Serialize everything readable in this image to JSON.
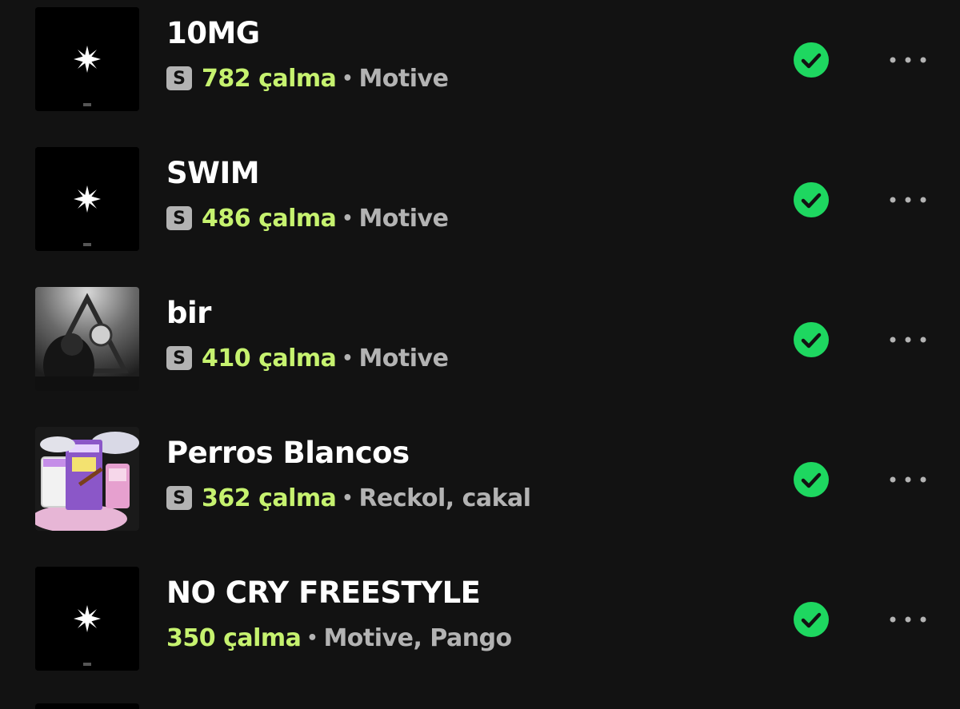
{
  "colors": {
    "background": "#121212",
    "plays_accent": "#c6f26f",
    "secondary_text": "#b3b3b3",
    "check_green": "#1ed760"
  },
  "tracks": [
    {
      "title": "10MG",
      "plays": "782 çalma",
      "separator": "•",
      "artists": "Motive",
      "has_badge": true,
      "badge": "S",
      "art": "black-star-cover",
      "downloaded_icon": "check-circle-icon",
      "more_icon": "more-options-icon"
    },
    {
      "title": "SWIM",
      "plays": "486 çalma",
      "separator": "•",
      "artists": "Motive",
      "has_badge": true,
      "badge": "S",
      "art": "black-star-cover",
      "downloaded_icon": "check-circle-icon",
      "more_icon": "more-options-icon"
    },
    {
      "title": "bir",
      "plays": "410 çalma",
      "separator": "•",
      "artists": "Motive",
      "has_badge": true,
      "badge": "S",
      "art": "grayscale-photo-cover",
      "downloaded_icon": "check-circle-icon",
      "more_icon": "more-options-icon"
    },
    {
      "title": "Perros Blancos",
      "plays": "362 çalma",
      "separator": "•",
      "artists": "Reckol, cakal",
      "has_badge": true,
      "badge": "S",
      "art": "pink-collage-cover",
      "downloaded_icon": "check-circle-icon",
      "more_icon": "more-options-icon"
    },
    {
      "title": "NO CRY FREESTYLE",
      "plays": "350 çalma",
      "separator": "•",
      "artists": "Motive, Pango",
      "has_badge": false,
      "badge": "",
      "art": "black-star-cover",
      "downloaded_icon": "check-circle-icon",
      "more_icon": "more-options-icon"
    }
  ]
}
